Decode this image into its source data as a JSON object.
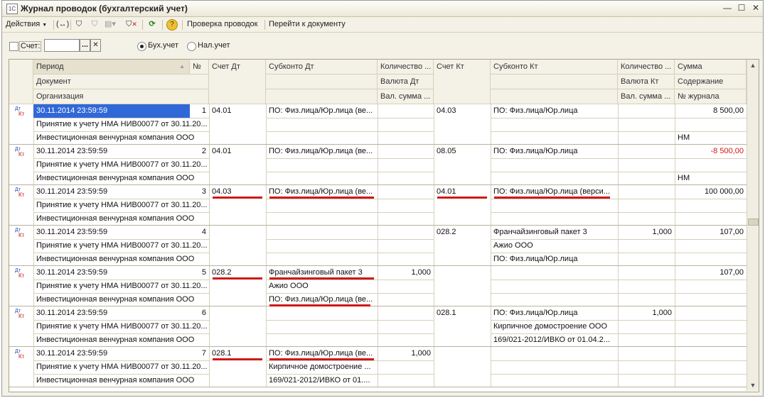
{
  "window": {
    "app_icon": "1C",
    "title": "Журнал проводок (бухгалтерский учет)",
    "minimize": "—",
    "maximize": "☐",
    "close": "✕"
  },
  "toolbar": {
    "actions_label": "Действия",
    "check_label": "Проверка проводок",
    "goto_label": "Перейти к документу"
  },
  "filter": {
    "account_label": "Счет:",
    "account_value": "",
    "choose_button": "...",
    "clear_button": "✕",
    "radio_buh": "Бух.учет",
    "radio_nal": "Нал.учет"
  },
  "columns": {
    "period": "Период",
    "number": "№",
    "document": "Документ",
    "organization": "Организация",
    "acc_dt": "Счет Дт",
    "sub_dt": "Субконто Дт",
    "qty_dt": "Количество ...",
    "cur_dt": "Валюта Дт",
    "cur_sum_dt": "Вал. сумма ...",
    "acc_kt": "Счет Кт",
    "sub_kt": "Субконто Кт",
    "qty_kt": "Количество ...",
    "cur_kt": "Валюта Кт",
    "cur_sum_kt": "Вал. сумма ...",
    "sum": "Сумма",
    "content": "Содержание",
    "journal": "№ журнала"
  },
  "rows": [
    {
      "period": "30.11.2014 23:59:59",
      "n": "1",
      "doc": "Принятие к учету НМА НИВ00077 от 30.11.20...",
      "org": "Инвестиционная венчурная компания ООО",
      "acc_dt": "04.01",
      "sub_dt": [
        "ПО: Физ.лица/Юр.лица (ве...",
        "",
        ""
      ],
      "qty_dt": "",
      "acc_kt": "04.03",
      "sub_kt": [
        "ПО: Физ.лица/Юр.лица",
        "",
        ""
      ],
      "qty_kt": "",
      "sum": "8 500,00",
      "content": "",
      "journal": "НМ"
    },
    {
      "period": "30.11.2014 23:59:59",
      "n": "2",
      "doc": "Принятие к учету НМА НИВ00077 от 30.11.20...",
      "org": "Инвестиционная венчурная компания ООО",
      "acc_dt": "04.01",
      "sub_dt": [
        "ПО: Физ.лица/Юр.лица (ве...",
        "",
        ""
      ],
      "qty_dt": "",
      "acc_kt": "08.05",
      "sub_kt": [
        "ПО: Физ.лица/Юр.лица",
        "",
        ""
      ],
      "qty_kt": "",
      "sum": "-8 500,00",
      "content": "",
      "journal": "НМ"
    },
    {
      "period": "30.11.2014 23:59:59",
      "n": "3",
      "doc": "Принятие к учету НМА НИВ00077 от 30.11.20...",
      "org": "Инвестиционная венчурная компания ООО",
      "acc_dt": "04.03",
      "sub_dt": [
        "ПО: Физ.лица/Юр.лица (ве...",
        "",
        ""
      ],
      "qty_dt": "",
      "acc_kt": "04.01",
      "sub_kt": [
        "ПО: Физ.лица/Юр.лица (верси...",
        "",
        ""
      ],
      "qty_kt": "",
      "sum": "100 000,00",
      "content": "",
      "journal": ""
    },
    {
      "period": "30.11.2014 23:59:59",
      "n": "4",
      "doc": "Принятие к учету НМА НИВ00077 от 30.11.20...",
      "org": "Инвестиционная венчурная компания ООО",
      "acc_dt": "",
      "sub_dt": [
        "",
        "",
        ""
      ],
      "qty_dt": "",
      "acc_kt": "028.2",
      "sub_kt": [
        "Франчайзинговый пакет 3",
        "Ажио ООО",
        "ПО: Физ.лица/Юр.лица"
      ],
      "qty_kt": "1,000",
      "sum": "107,00",
      "content": "",
      "journal": ""
    },
    {
      "period": "30.11.2014 23:59:59",
      "n": "5",
      "doc": "Принятие к учету НМА НИВ00077 от 30.11.20...",
      "org": "Инвестиционная венчурная компания ООО",
      "acc_dt": "028.2",
      "sub_dt": [
        "Франчайзинговый пакет 3",
        "Ажио ООО",
        "ПО: Физ.лица/Юр.лица (ве..."
      ],
      "qty_dt": "1,000",
      "acc_kt": "",
      "sub_kt": [
        "",
        "",
        ""
      ],
      "qty_kt": "",
      "sum": "107,00",
      "content": "",
      "journal": ""
    },
    {
      "period": "30.11.2014 23:59:59",
      "n": "6",
      "doc": "Принятие к учету НМА НИВ00077 от 30.11.20...",
      "org": "Инвестиционная венчурная компания ООО",
      "acc_dt": "",
      "sub_dt": [
        "",
        "",
        ""
      ],
      "qty_dt": "",
      "acc_kt": "028.1",
      "sub_kt": [
        "ПО: Физ.лица/Юр.лица",
        "Кирпичное домостроение ООО",
        "169/021-2012/ИВКО от 01.04.2..."
      ],
      "qty_kt": "1,000",
      "sum": "",
      "content": "",
      "journal": ""
    },
    {
      "period": "30.11.2014 23:59:59",
      "n": "7",
      "doc": "Принятие к учету НМА НИВ00077 от 30.11.20...",
      "org": "Инвестиционная венчурная компания ООО",
      "acc_dt": "028.1",
      "sub_dt": [
        "ПО: Физ.лица/Юр.лица (ве...",
        "Кирпичное домостроение ...",
        "169/021-2012/ИВКО от 01...."
      ],
      "qty_dt": "1,000",
      "acc_kt": "",
      "sub_kt": [
        "",
        "",
        ""
      ],
      "qty_kt": "",
      "sum": "",
      "content": "",
      "journal": ""
    }
  ],
  "row_icon": {
    "dt": "Дт",
    "kt": "Кт"
  },
  "colors": {
    "negative": "#d01818",
    "selection": "#3068d8",
    "underline": "#d01818"
  }
}
